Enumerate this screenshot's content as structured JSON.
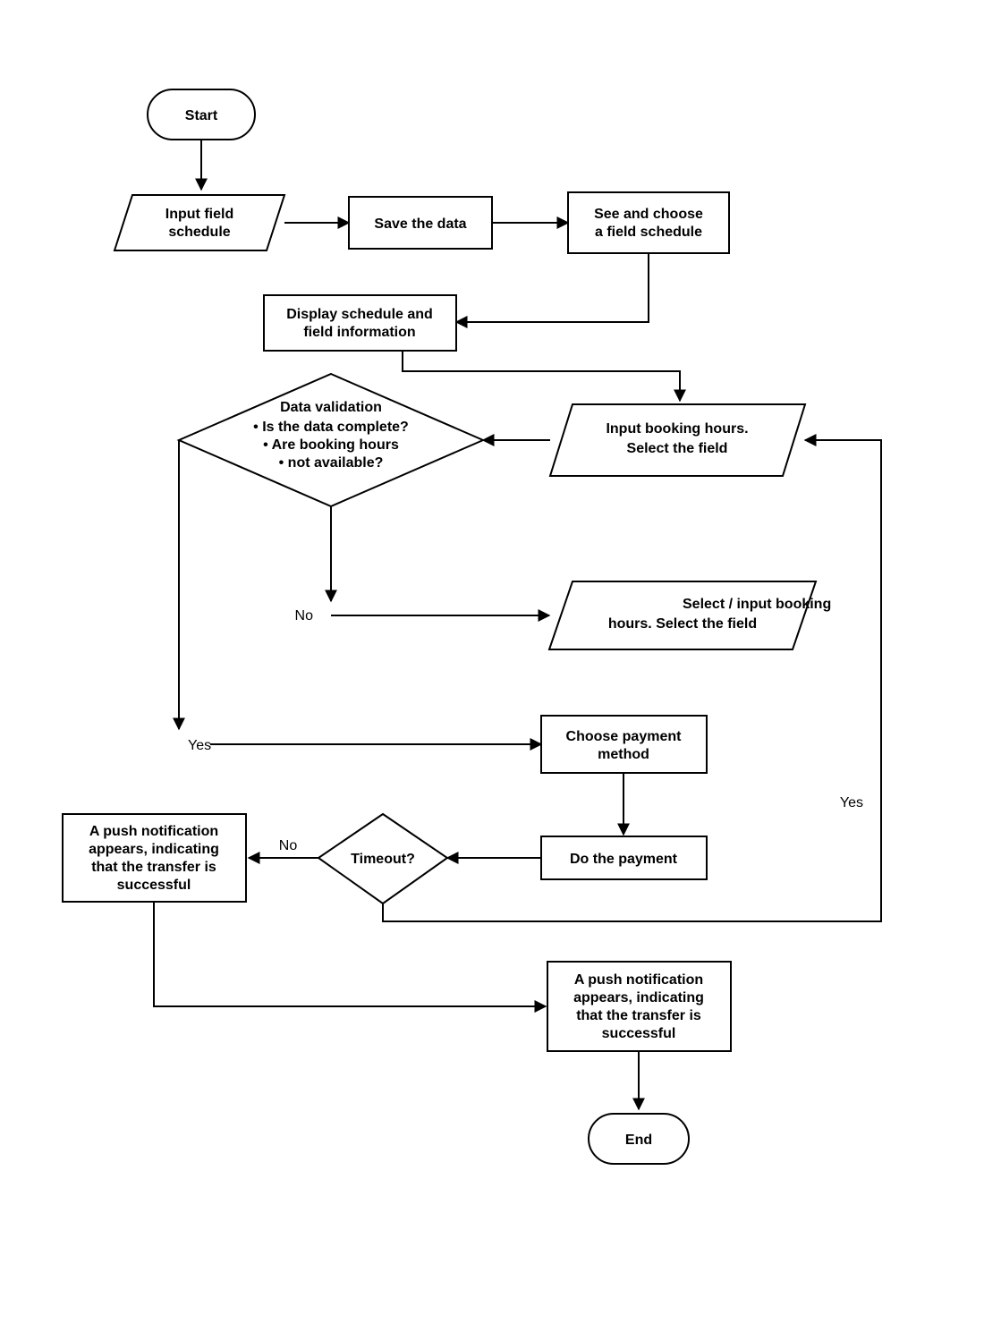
{
  "nodes": {
    "start": "Start",
    "input_schedule": [
      "Input field",
      "schedule"
    ],
    "save_data": "Save the data",
    "choose_schedule": [
      "See and choose",
      "a field schedule"
    ],
    "display_info": [
      "Display schedule and",
      "field information"
    ],
    "validation_title": "Data validation",
    "validation_bullets": [
      "Is the data complete?",
      "Are booking hours",
      "not available?"
    ],
    "input_booking": [
      "Input booking hours.",
      "Select the field"
    ],
    "select_booking": [
      "Select / input booking",
      "hours. Select the field"
    ],
    "choose_payment": [
      "Choose payment",
      "method"
    ],
    "do_payment": "Do the payment",
    "timeout": "Timeout?",
    "push1": [
      "A push notification",
      "appears, indicating",
      "that the transfer is",
      "successful"
    ],
    "push2": [
      "A push notification",
      "appears, indicating",
      "that the transfer is",
      "successful"
    ],
    "end": "End"
  },
  "edges": {
    "no1": "No",
    "yes1": "Yes",
    "no2": "No",
    "yes2": "Yes"
  }
}
